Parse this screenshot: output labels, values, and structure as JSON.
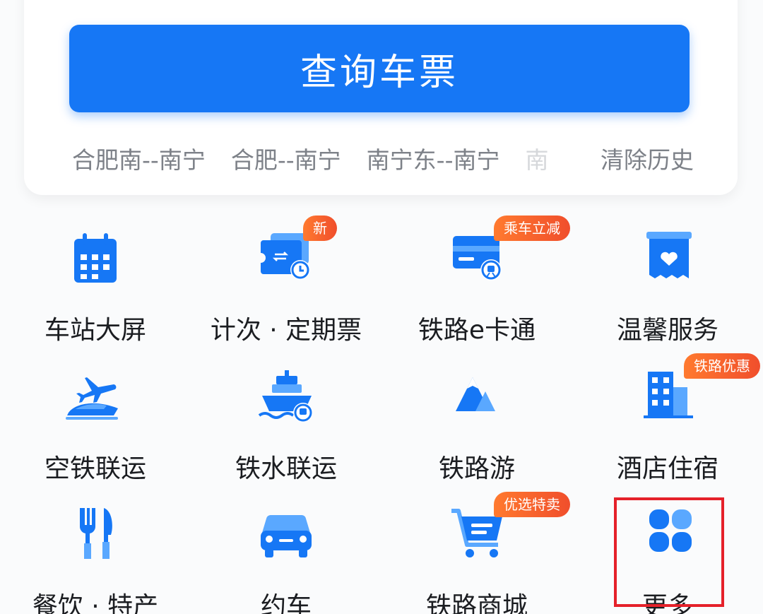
{
  "query_button": {
    "label": "查询车票"
  },
  "history": {
    "items": [
      "合肥南--南宁",
      "合肥--南宁",
      "南宁东--南宁"
    ],
    "faded_item": "南",
    "clear_label": "清除历史"
  },
  "grid": [
    {
      "label": "车站大屏",
      "icon": "calendar-icon"
    },
    {
      "label": "计次 · 定期票",
      "icon": "ticket-clock-icon",
      "badge": "新"
    },
    {
      "label": "铁路e卡通",
      "icon": "card-train-icon",
      "badge": "乘车立减"
    },
    {
      "label": "温馨服务",
      "icon": "heart-box-icon"
    },
    {
      "label": "空铁联运",
      "icon": "plane-train-icon"
    },
    {
      "label": "铁水联运",
      "icon": "ship-train-icon"
    },
    {
      "label": "铁路游",
      "icon": "mountain-icon"
    },
    {
      "label": "酒店住宿",
      "icon": "hotel-building-icon",
      "badge": "铁路优惠"
    },
    {
      "label": "餐饮 · 特产",
      "icon": "fork-knife-icon"
    },
    {
      "label": "约车",
      "icon": "car-icon"
    },
    {
      "label": "铁路商城",
      "icon": "shopping-cart-icon",
      "badge": "优选特卖"
    },
    {
      "label": "更多",
      "icon": "more-grid-icon"
    }
  ],
  "colors": {
    "primary": "#1677f5",
    "light_blue": "#5aa8ff",
    "badge": "#f25a2c",
    "highlight": "#e5212a"
  }
}
